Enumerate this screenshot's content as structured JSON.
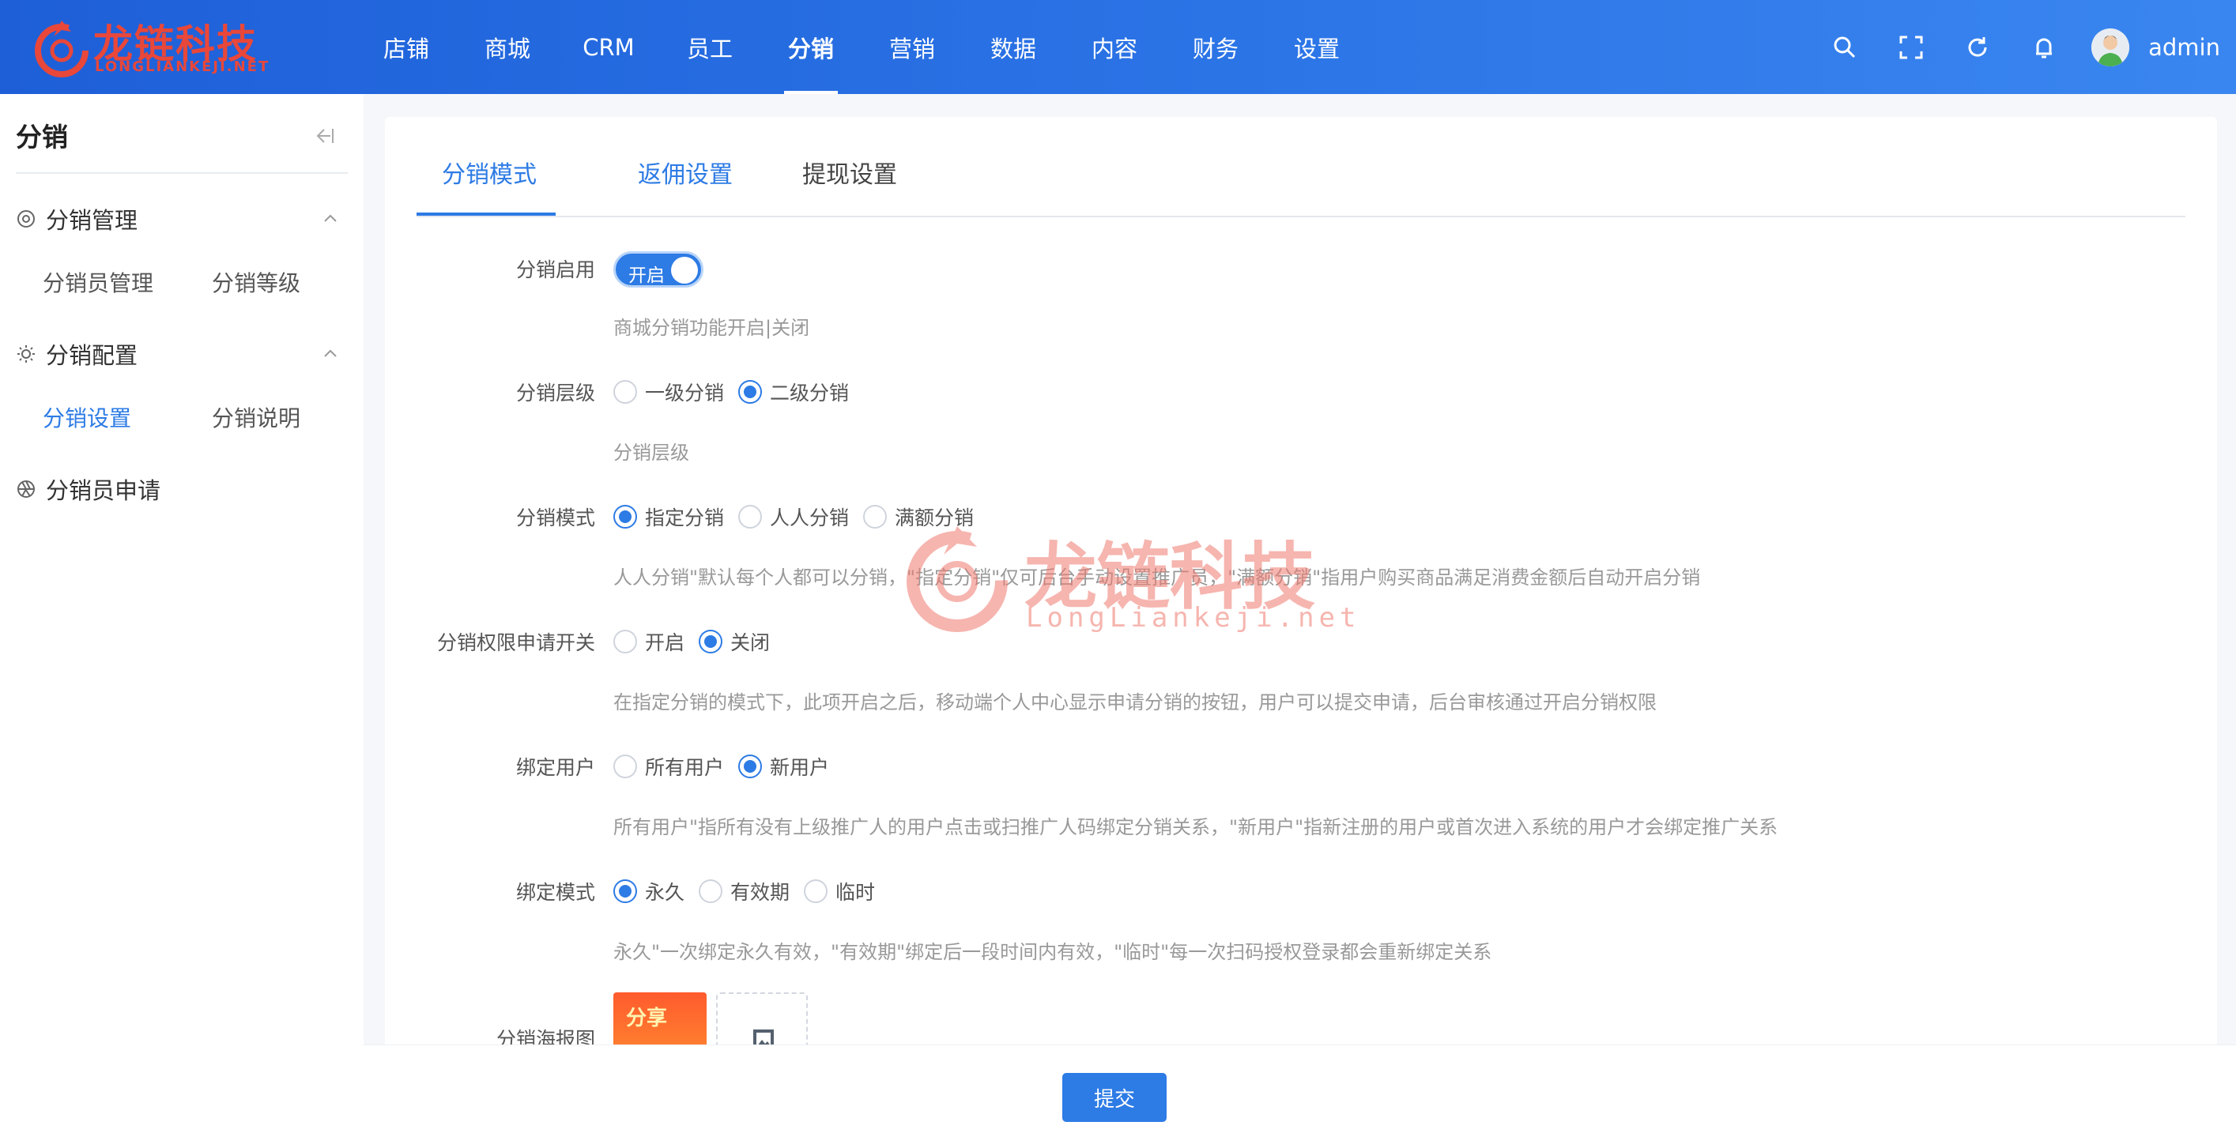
{
  "brand": {
    "name_cn": "龙链科技",
    "name_en": "LONGLIANKEJI.NET",
    "color": "#e8473a"
  },
  "nav": {
    "items": [
      {
        "label": "店铺"
      },
      {
        "label": "商城"
      },
      {
        "label": "CRM"
      },
      {
        "label": "员工"
      },
      {
        "label": "分销",
        "active": true
      },
      {
        "label": "营销"
      },
      {
        "label": "数据"
      },
      {
        "label": "内容"
      },
      {
        "label": "财务"
      },
      {
        "label": "设置"
      }
    ],
    "icons": [
      "search-icon",
      "fullscreen-icon",
      "refresh-icon",
      "bell-icon"
    ],
    "user": "admin"
  },
  "sidebar": {
    "title": "分销",
    "groups": [
      {
        "label": "分销管理",
        "icon": "gear-circle-icon",
        "items": [
          {
            "label": "分销员管理"
          },
          {
            "label": "分销等级"
          }
        ]
      },
      {
        "label": "分销配置",
        "icon": "bulb-icon",
        "items": [
          {
            "label": "分销设置",
            "active": true
          },
          {
            "label": "分销说明"
          }
        ]
      },
      {
        "label": "分销员申请",
        "icon": "aperture-icon",
        "items": []
      }
    ]
  },
  "tabs": [
    {
      "label": "分销模式",
      "active": true
    },
    {
      "label": "返佣设置"
    },
    {
      "label": "提现设置"
    }
  ],
  "form": {
    "enable": {
      "label": "分销启用",
      "switch_text": "开启",
      "on": true,
      "hint": "商城分销功能开启|关闭"
    },
    "level": {
      "label": "分销层级",
      "options": [
        "一级分销",
        "二级分销"
      ],
      "selected": "二级分销",
      "hint": "分销层级"
    },
    "mode": {
      "label": "分销模式",
      "options": [
        "指定分销",
        "人人分销",
        "满额分销"
      ],
      "selected": "指定分销",
      "hint": "人人分销\"默认每个人都可以分销，\"指定分销\"仅可后台手动设置推广员，\"满额分销\"指用户购买商品满足消费金额后自动开启分销"
    },
    "apply": {
      "label": "分销权限申请开关",
      "options": [
        "开启",
        "关闭"
      ],
      "selected": "关闭",
      "hint": "在指定分销的模式下，此项开启之后，移动端个人中心显示申请分销的按钮，用户可以提交申请，后台审核通过开启分销权限"
    },
    "bind_user": {
      "label": "绑定用户",
      "options": [
        "所有用户",
        "新用户"
      ],
      "selected": "新用户",
      "hint": "所有用户\"指所有没有上级推广人的用户点击或扫推广人码绑定分销关系，\"新用户\"指新注册的用户或首次进入系统的用户才会绑定推广关系"
    },
    "bind_mode": {
      "label": "绑定模式",
      "options": [
        "永久",
        "有效期",
        "临时"
      ],
      "selected": "永久",
      "hint": "永久\"一次绑定永久有效，\"有效期\"绑定后一段时间内有效，\"临时\"每一次扫码授权登录都会重新绑定关系"
    },
    "poster": {
      "label": "分销海报图",
      "poster_text": "分享"
    }
  },
  "watermark": {
    "cn": "龙链科技",
    "en": "LongLiankeji.net"
  },
  "submit_label": "提交",
  "colors": {
    "primary": "#2d7be5",
    "topbar": "#2b74e6"
  }
}
